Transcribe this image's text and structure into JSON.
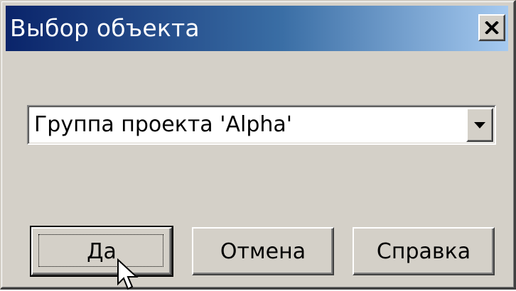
{
  "dialog": {
    "title": "Выбор объекта",
    "close_icon": "close-icon"
  },
  "combo": {
    "selected_value": "Группа проекта 'Alpha'",
    "arrow_icon": "chevron-down-icon"
  },
  "buttons": {
    "ok_label": "Да",
    "cancel_label": "Отмена",
    "help_label": "Справка"
  },
  "colors": {
    "titlebar_start": "#0a246a",
    "titlebar_end": "#a6caf0",
    "face": "#d4d0c8"
  }
}
